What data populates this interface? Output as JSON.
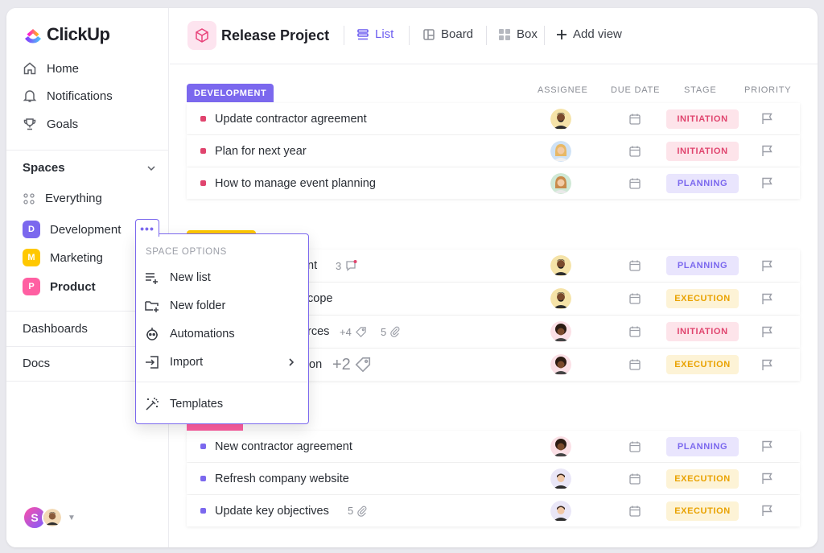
{
  "app": {
    "name": "ClickUp"
  },
  "sidebar": {
    "nav": [
      {
        "label": "Home"
      },
      {
        "label": "Notifications"
      },
      {
        "label": "Goals"
      }
    ],
    "spaces_title": "Spaces",
    "everything_label": "Everything",
    "spaces": [
      {
        "letter": "D",
        "label": "Development",
        "color": "#7b68ee"
      },
      {
        "letter": "M",
        "label": "Marketing",
        "color": "#ffc800"
      },
      {
        "letter": "P",
        "label": "Product",
        "color": "#ff5fa2"
      }
    ],
    "dashboards_label": "Dashboards",
    "docs_label": "Docs",
    "user_initial": "S"
  },
  "space_options": {
    "title": "SPACE OPTIONS",
    "items": [
      {
        "label": "New list",
        "icon": "new-list-icon"
      },
      {
        "label": "New folder",
        "icon": "new-folder-icon"
      },
      {
        "label": "Automations",
        "icon": "robot-icon"
      },
      {
        "label": "Import",
        "icon": "import-icon"
      },
      {
        "label": "Templates",
        "icon": "magic-wand-icon"
      }
    ]
  },
  "header": {
    "project_title": "Release Project",
    "views": [
      {
        "label": "List",
        "icon": "list-icon",
        "active": true
      },
      {
        "label": "Board",
        "icon": "board-icon"
      },
      {
        "label": "Box",
        "icon": "box-icon"
      },
      {
        "label": "Add view",
        "icon": "plus-icon"
      }
    ]
  },
  "columns": {
    "assignee": "ASSIGNEE",
    "due_date": "DUE DATE",
    "stage": "STAGE",
    "priority": "PRIORITY"
  },
  "groups": [
    {
      "label": "DEVELOPMENT",
      "color": "#7b68ee"
    },
    {
      "label": "",
      "color": "#ffc800"
    },
    {
      "label": "",
      "color": "#ff5fa2"
    }
  ],
  "tasks": [
    {
      "name": "Update contractor agreement",
      "stage": "INITIATION"
    },
    {
      "name": "Plan for next year",
      "stage": "INITIATION"
    },
    {
      "name": "How to manage event planning",
      "stage": "PLANNING"
    },
    {
      "name": "nt",
      "stage": "PLANNING",
      "comments": "3"
    },
    {
      "name": "cope",
      "stage": "EXECUTION"
    },
    {
      "name": "rces",
      "stage": "INITIATION",
      "tags": "+4",
      "attachments": "5"
    },
    {
      "name": "on",
      "stage": "EXECUTION",
      "tags": "+2"
    },
    {
      "name": "New contractor agreement",
      "stage": "PLANNING"
    },
    {
      "name": "Refresh company website",
      "stage": "EXECUTION"
    },
    {
      "name": "Update key objectives",
      "stage": "EXECUTION",
      "attachments": "5"
    }
  ]
}
